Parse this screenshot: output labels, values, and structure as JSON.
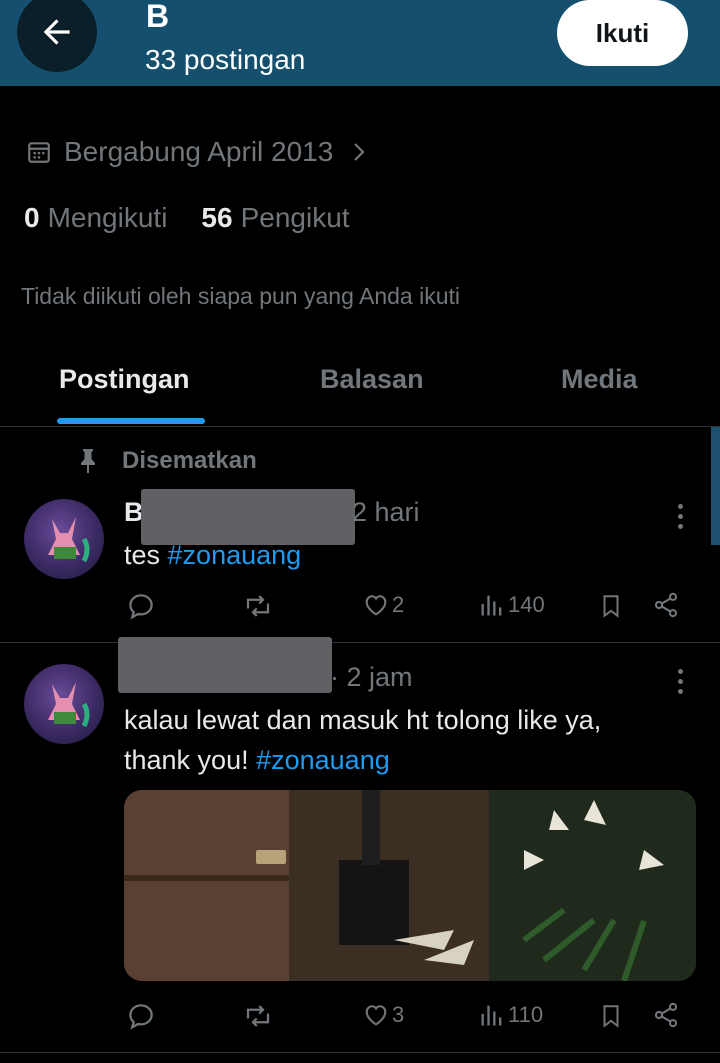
{
  "header": {
    "title": "B",
    "post_count": "33 postingan",
    "follow_label": "Ikuti",
    "bg_color": "#14506e"
  },
  "profile": {
    "joined": "Bergabung April 2013",
    "following_count": "0",
    "following_label": "Mengikuti",
    "followers_count": "56",
    "followers_label": "Pengikut",
    "not_followed_text": "Tidak diikuti oleh siapa pun yang Anda ikuti"
  },
  "tabs": [
    {
      "label": "Postingan",
      "active": true
    },
    {
      "label": "Balasan",
      "active": false
    },
    {
      "label": "Media",
      "active": false
    }
  ],
  "pinned_label": "Disematkan",
  "posts": [
    {
      "author_initial": "B",
      "time": "2 hari",
      "text": "tes ",
      "hashtag": "#zonauang",
      "likes": "2",
      "views": "140"
    },
    {
      "time": "· 2 jam",
      "text_line1": "kalau lewat dan masuk ht tolong like ya,",
      "text_line2": "thank you! ",
      "hashtag": "#zonauang",
      "likes": "3",
      "views": "110"
    }
  ],
  "icons": [
    "back-arrow-icon",
    "calendar-icon",
    "chevron-right-icon",
    "pin-icon",
    "reply-icon",
    "repost-icon",
    "like-icon",
    "views-icon",
    "bookmark-icon",
    "share-icon",
    "more-icon"
  ],
  "colors": {
    "accent": "#1d9bf0",
    "muted": "#71767b",
    "text": "#e7e9ea"
  }
}
